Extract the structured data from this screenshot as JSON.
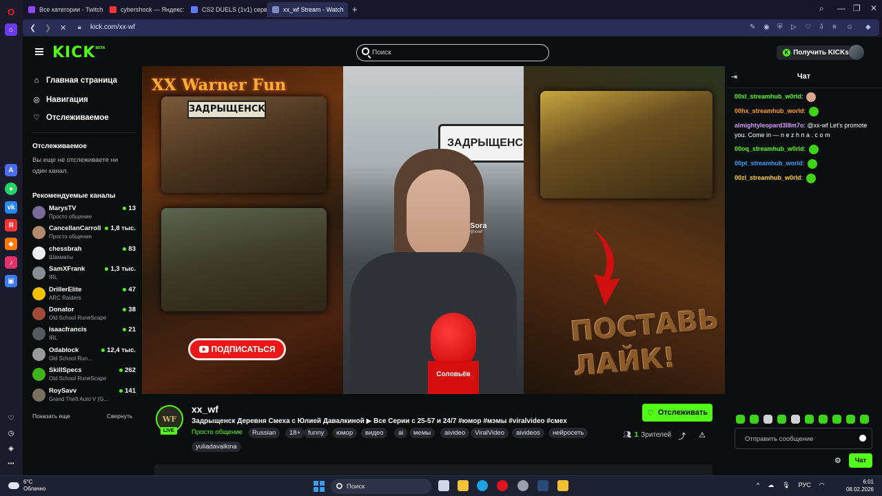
{
  "browser": {
    "tabs": [
      {
        "label": "Все категории - Twitch",
        "color": "#9146ff"
      },
      {
        "label": "cybershock — Яндекс: на",
        "color": "#f33"
      },
      {
        "label": "CS2 DUELS (1v1) сервер",
        "color": "#5b7cff"
      },
      {
        "label": "xx_wf Stream - Watch",
        "color": "#3a3f6a"
      }
    ],
    "url": "kick.com/xx-wf"
  },
  "header": {
    "logo": "KICK",
    "logo_badge": "BETA",
    "search_placeholder": "Поиск",
    "get_kicks": "Получить KICKs"
  },
  "sidebar": {
    "nav": [
      {
        "label": "Главная страница",
        "icon": "home-icon"
      },
      {
        "label": "Навигация",
        "icon": "compass-icon"
      },
      {
        "label": "Отслеживаемое",
        "icon": "heart-icon"
      }
    ],
    "following_title": "Отслеживаемое",
    "following_empty": "Вы еще не отслеживаете ни один канал.",
    "recommended_title": "Рекомендуемые каналы",
    "channels": [
      {
        "name": "MarysTV",
        "category": "Просто общение",
        "viewers": "13",
        "color": "#7a6a9a"
      },
      {
        "name": "CancellanCarroll",
        "category": "Просто общение",
        "viewers": "1,8 тыс.",
        "color": "#b58a6a"
      },
      {
        "name": "chessbrah",
        "category": "Шахматы",
        "viewers": "83",
        "color": "#f0f0f0"
      },
      {
        "name": "SamXFrank",
        "category": "IRL",
        "viewers": "1,3 тыс.",
        "color": "#8a8f94"
      },
      {
        "name": "DrillerElite",
        "category": "ARC Raiders",
        "viewers": "47",
        "color": "#f2c200"
      },
      {
        "name": "Donator",
        "category": "Old School RuneScape",
        "viewers": "38",
        "color": "#a04a3a"
      },
      {
        "name": "isaacfrancis",
        "category": "IRL",
        "viewers": "21",
        "color": "#555a5f"
      },
      {
        "name": "Odablock",
        "category": "Old School Run...",
        "viewers": "12,4 тыс.",
        "color": "#9a9a9a"
      },
      {
        "name": "SkillSpecs",
        "category": "Old School RuneScape",
        "viewers": "262",
        "color": "#3fb41a"
      },
      {
        "name": "RoySavv",
        "category": "Grand Theft Auto V (G...",
        "viewers": "141",
        "color": "#7a7060"
      }
    ],
    "show_more": "Показать еще",
    "collapse": "Свернуть"
  },
  "video": {
    "banner_title": "XX Warner Fun",
    "sign_text": "ЗАДРЫЩЕНСК",
    "road_sign": "ЗАДРЫЩЕНС",
    "subscribe": "ПОДПИСАТЬСЯ",
    "watermark": "Sora",
    "watermark_handle": "@xxwf",
    "mic_label": "Соловьёв",
    "like_text_1": "ПОСТАВЬ",
    "like_text_2": "ЛАЙК!"
  },
  "stream": {
    "channel": "xx_wf",
    "avatar_text": "WF",
    "live": "LIVE",
    "title": "Задрыщенск Деревня Смеха с Юлией Давалкиной ▶ Все Серии с 25-57 и 24/7 #юмор #мэмы #viralvideo #смех",
    "category": "Просто общение",
    "tags": [
      "Russian",
      "18+",
      "funny",
      "юмор",
      "видео",
      "ai",
      "мемы",
      "aivideo",
      "ViralVideo",
      "aivideos",
      "нейросеть",
      "yuliadavalkina"
    ],
    "follow": "Отслеживать",
    "viewers_count": "1",
    "viewers_label": "Зрителей"
  },
  "chat": {
    "title": "Чат",
    "messages": [
      {
        "user": "00xl_streamhub_w0rld",
        "color": "#53fc18",
        "text": ""
      },
      {
        "user": "00hx_streamhub_world",
        "color": "#ff9f1a",
        "text": ""
      },
      {
        "user": "almightyleopard3l8m7o",
        "color": "#d59cff",
        "text": "@xx-wf Let's promote you. Come in — n e z h n a . c o m"
      },
      {
        "user": "00oq_streamhub_w0rld",
        "color": "#53fc18",
        "text": ""
      },
      {
        "user": "00pt_streamhub_world",
        "color": "#3aa0ff",
        "text": ""
      },
      {
        "user": "00zl_streamhub_w0rld",
        "color": "#ffcf40",
        "text": ""
      }
    ],
    "input_placeholder": "Отправить сообщение",
    "send": "Чат"
  },
  "taskbar": {
    "temp": "6°C",
    "weather": "Облачно",
    "search": "Поиск",
    "lang": "РУС",
    "time": "6:01",
    "date": "08.02.2026"
  }
}
